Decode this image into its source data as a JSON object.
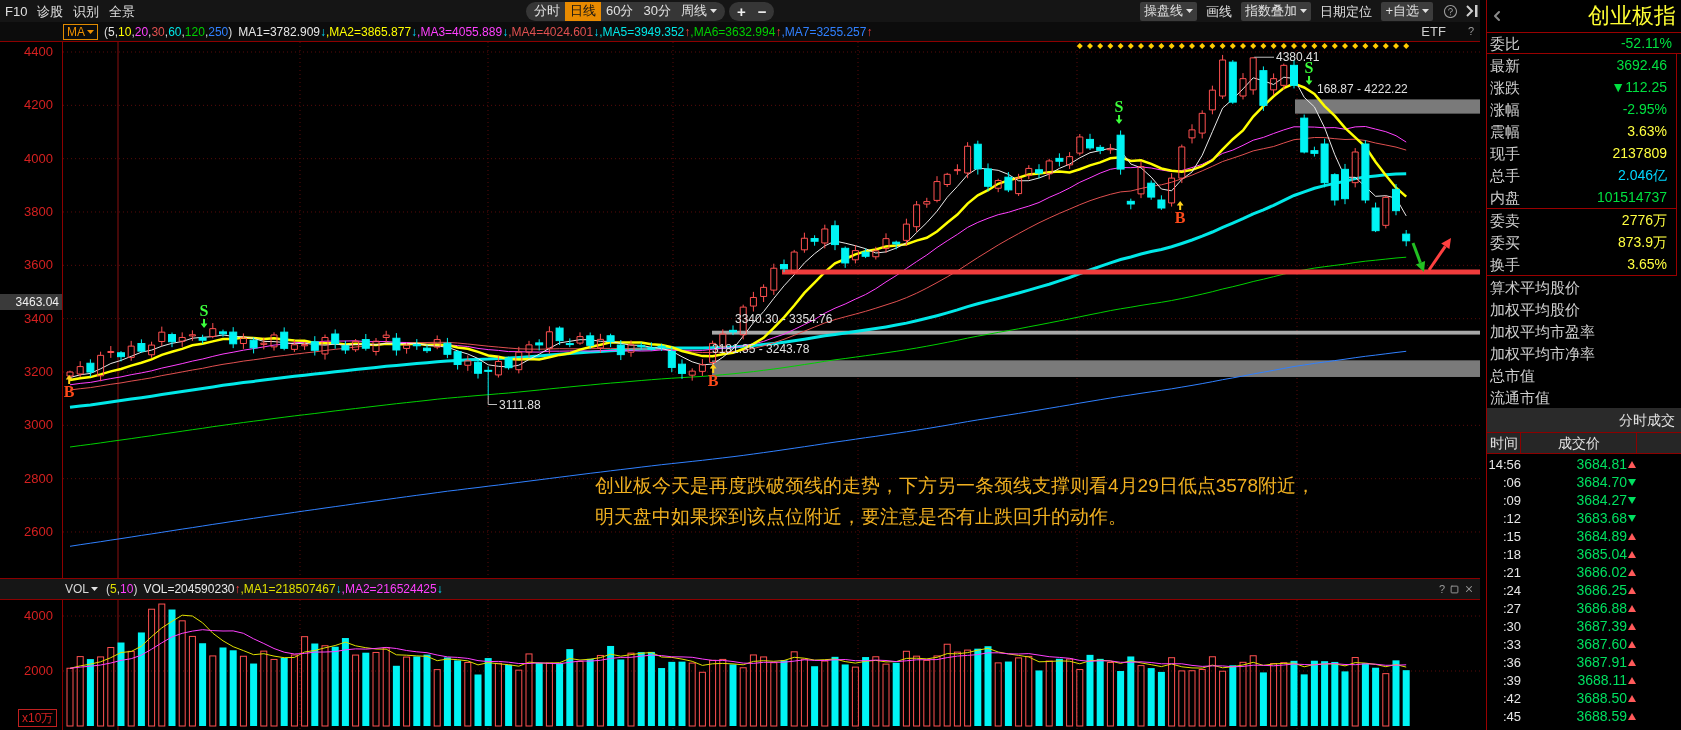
{
  "toolbar": {
    "left_items": [
      "F10",
      "诊股",
      "识别",
      "全景"
    ],
    "periods": [
      {
        "label": "分时",
        "kind": "plain",
        "selected": false
      },
      {
        "label": "日线",
        "kind": "plain",
        "selected": true
      },
      {
        "label": "60分",
        "kind": "plain",
        "selected": false
      },
      {
        "label": "30分",
        "kind": "plain",
        "selected": false
      },
      {
        "label": "周线",
        "kind": "dropdown",
        "selected": false
      }
    ],
    "zoom_buttons": [
      "+",
      "−"
    ],
    "right_items": [
      {
        "label": "操盘线",
        "kind": "dropdown"
      },
      {
        "label": "画线",
        "kind": "plain"
      },
      {
        "label": "指数叠加",
        "kind": "dropdown"
      },
      {
        "label": "日期定位",
        "kind": "plain"
      },
      {
        "label": "+自选",
        "kind": "dropdown"
      }
    ]
  },
  "main_chart": {
    "legend": {
      "indicator": "MA",
      "open": "(",
      "separator": ",",
      "close": ")",
      "params": [
        {
          "value": "5",
          "color": "#e8e8e8"
        },
        {
          "value": "10",
          "color": "#ffff00"
        },
        {
          "value": "20",
          "color": "#ff40ff"
        },
        {
          "value": "30",
          "color": "#e05050"
        },
        {
          "value": "60",
          "color": "#00e8e8"
        },
        {
          "value": "120",
          "color": "#00d000"
        },
        {
          "value": "250",
          "color": "#3080ff"
        }
      ],
      "values": [
        {
          "label": "MA1=3782.909",
          "color": "#e8e8e8",
          "arrow": "↓",
          "rising": false
        },
        {
          "label": ",MA2=3865.877",
          "color": "#ffff00",
          "arrow": "↓",
          "rising": false
        },
        {
          "label": ",MA3=4055.889",
          "color": "#ff40ff",
          "arrow": "↓",
          "rising": false
        },
        {
          "label": ",MA4=4024.601",
          "color": "#e05050",
          "arrow": "↓",
          "rising": false
        },
        {
          "label": ",MA5=3949.352",
          "color": "#00e8e8",
          "arrow": "↑",
          "rising": true
        },
        {
          "label": ",MA6=3632.994",
          "color": "#00d000",
          "arrow": "↑",
          "rising": true
        },
        {
          "label": ",MA7=3255.257",
          "color": "#3080ff",
          "arrow": "↑",
          "rising": true
        }
      ],
      "tag": "ETF",
      "help": "?"
    },
    "y_axis": [
      "4400",
      "4200",
      "4000",
      "3800",
      "3600",
      "3400",
      "3200",
      "3000",
      "2800",
      "2600"
    ],
    "crosshair_price": "3463.04",
    "price_labels": [
      "4380.41",
      "168.87 - 4222.22",
      "3340.30 - 3354.76",
      "3181.35 - 3243.78",
      "3111.88"
    ],
    "markers": [
      {
        "kind": "buy",
        "letter": "B"
      },
      {
        "kind": "sell",
        "letter": "S"
      },
      {
        "kind": "buy",
        "letter": "B"
      },
      {
        "kind": "sell",
        "letter": "S"
      },
      {
        "kind": "buy",
        "letter": "B"
      },
      {
        "kind": "sell",
        "letter": "S"
      }
    ],
    "note": [
      "创业板今天是再度跌破颈线的走势，下方另一条颈线支撑则看4月29日低点3578附近，",
      "明天盘中如果探到该点位附近，要注意是否有止跌回升的动作。"
    ]
  },
  "volume_chart": {
    "legend": {
      "indicator": "VOL",
      "open": "(",
      "separator": ",",
      "close": ")",
      "params": [
        {
          "value": "5",
          "color": "#e0e000"
        },
        {
          "value": "10",
          "color": "#ff40ff"
        }
      ],
      "values": [
        {
          "label": "VOL=204590230",
          "color": "#e8e8e8",
          "arrow": "↑",
          "rising": true
        },
        {
          "label": ",MA1=218507467",
          "color": "#e0e000",
          "arrow": "↓",
          "rising": false
        },
        {
          "label": ",MA2=216524425",
          "color": "#ff40ff",
          "arrow": "↓",
          "rising": false
        }
      ],
      "help": "?"
    },
    "y_axis": [
      "4000",
      "2000"
    ],
    "unit": "x10万"
  },
  "quote_panel": {
    "title": "创业板指",
    "summary": [
      {
        "label": "委比",
        "value": "-52.11%",
        "color": "#00e040"
      }
    ],
    "stats": [
      {
        "label": "最新",
        "value": "3692.46",
        "color": "#00e040"
      },
      {
        "label": "涨跌",
        "value": "▼112.25",
        "color": "#00e040"
      },
      {
        "label": "涨幅",
        "value": "-2.95%",
        "color": "#00e040"
      },
      {
        "label": "震幅",
        "value": "3.63%",
        "color": "#ffff40"
      },
      {
        "label": "现手",
        "value": "2137809",
        "color": "#ffff40"
      },
      {
        "label": "总手",
        "value": "2.046亿",
        "color": "#00d8ff"
      },
      {
        "label": "内盘",
        "value": "101514737",
        "color": "#00e040"
      }
    ],
    "orders": [
      {
        "label": "委卖",
        "value": "2776万",
        "color": "#ffff40"
      },
      {
        "label": "委买",
        "value": "873.9万",
        "color": "#ffff40"
      },
      {
        "label": "换手",
        "value": "3.65%",
        "color": "#ffff40"
      }
    ],
    "averages": [
      "算术平均股价",
      "加权平均股价",
      "加权平均市盈率",
      "加权平均市净率",
      "总市值",
      "流通市值"
    ],
    "trades_title": "分时成交",
    "trade_columns": [
      "时间",
      "成交价"
    ],
    "trades": [
      {
        "time": "14:56",
        "price": "3684.81",
        "kind": "up"
      },
      {
        "time": ":06",
        "price": "3684.70",
        "kind": "down"
      },
      {
        "time": ":09",
        "price": "3684.27",
        "kind": "down"
      },
      {
        "time": ":12",
        "price": "3683.68",
        "kind": "down"
      },
      {
        "time": ":15",
        "price": "3684.89",
        "kind": "up"
      },
      {
        "time": ":18",
        "price": "3685.04",
        "kind": "up"
      },
      {
        "time": ":21",
        "price": "3686.02",
        "kind": "up"
      },
      {
        "time": ":24",
        "price": "3686.25",
        "kind": "up"
      },
      {
        "time": ":27",
        "price": "3686.88",
        "kind": "up"
      },
      {
        "time": ":30",
        "price": "3687.39",
        "kind": "up"
      },
      {
        "time": ":33",
        "price": "3687.60",
        "kind": "up"
      },
      {
        "time": ":36",
        "price": "3687.91",
        "kind": "up"
      },
      {
        "time": ":39",
        "price": "3688.11",
        "kind": "up"
      },
      {
        "time": ":42",
        "price": "3688.50",
        "kind": "up"
      },
      {
        "time": ":45",
        "price": "3688.59",
        "kind": "up"
      }
    ]
  }
}
